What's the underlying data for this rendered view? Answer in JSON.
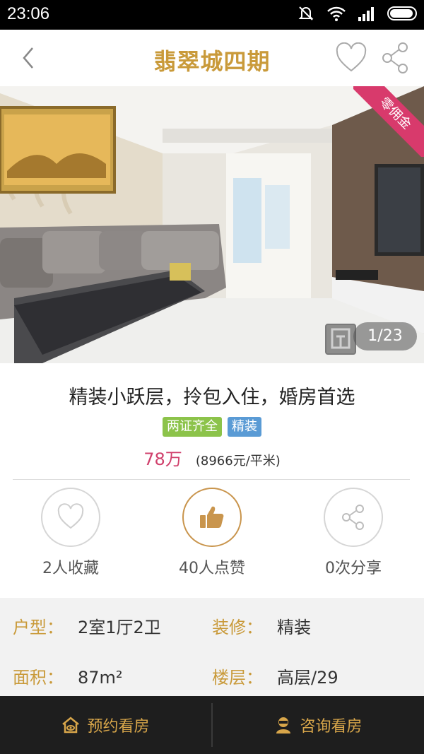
{
  "status_bar": {
    "time": "23:06",
    "icons": [
      "mute-icon",
      "wifi-icon",
      "signal-icon",
      "battery-icon"
    ]
  },
  "header": {
    "title": "翡翠城四期",
    "back_icon": "chevron-left-icon",
    "favorite_icon": "heart-outline-icon",
    "share_icon": "share-icon"
  },
  "gallery": {
    "ribbon_text": "零佣金",
    "counter_text": "1/23",
    "current_index": 1,
    "total": 23
  },
  "listing": {
    "title": "精装小跃层，拎包入住，婚房首选",
    "tags": [
      "两证齐全",
      "精装"
    ],
    "price": "78万",
    "unit_price": "(8966元/平米)"
  },
  "stats": [
    {
      "label": "2人收藏",
      "icon": "heart-outline-icon"
    },
    {
      "label": "40人点赞",
      "icon": "thumbs-up-icon"
    },
    {
      "label": "0次分享",
      "icon": "share-icon"
    }
  ],
  "attributes": [
    {
      "key": "户型：",
      "value": "2室1厅2卫"
    },
    {
      "key": "装修：",
      "value": "精装"
    },
    {
      "key": "面积：",
      "value": "87m²"
    },
    {
      "key": "楼层：",
      "value": "高层/29"
    }
  ],
  "bottom_bar": {
    "book_label": "预约看房",
    "consult_label": "咨询看房"
  },
  "colors": {
    "accent_gold": "#c99a3a",
    "price_pink": "#d0406c",
    "tag_green": "#8cc34a",
    "tag_blue": "#5a9bd5",
    "ribbon_pink": "#d83a6c",
    "bottom_bar_bg": "#1e1e1e"
  }
}
